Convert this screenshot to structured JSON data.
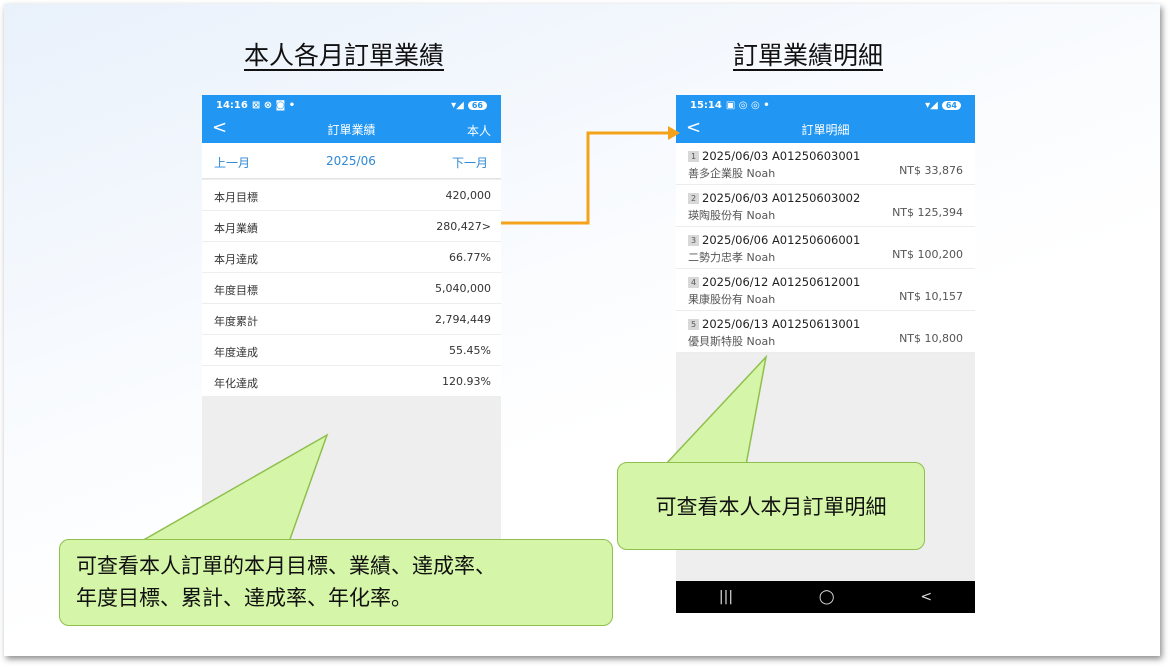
{
  "left_title": "本人各月訂單業績",
  "right_title": "訂單業績明細",
  "left_phone": {
    "status_time": "14:16",
    "status_icons": "⊠ ⊗ ◙ •",
    "battery": "66",
    "nav_back": "<",
    "nav_title": "訂單業績",
    "nav_right": "本人",
    "prev_label": "上一月",
    "month": "2025/06",
    "next_label": "下一月",
    "monthly_rows": [
      {
        "label": "本月目標",
        "value": "420,000"
      },
      {
        "label": "本月業績",
        "value": "280,427>"
      },
      {
        "label": "本月達成",
        "value": "66.77%"
      }
    ],
    "yearly_rows": [
      {
        "label": "年度目標",
        "value": "5,040,000"
      },
      {
        "label": "年度累計",
        "value": "2,794,449"
      },
      {
        "label": "年度達成",
        "value": "55.45%"
      },
      {
        "label": "年化達成",
        "value": "120.93%"
      }
    ]
  },
  "right_phone": {
    "status_time": "15:14",
    "status_icons": "▣ ◎ ◎ •",
    "battery": "64",
    "nav_back": "<",
    "nav_title": "訂單明細",
    "orders": [
      {
        "index": "1",
        "title": "2025/06/03 A01250603001",
        "customer": "善多企業股 Noah",
        "amount": "NT$ 33,876"
      },
      {
        "index": "2",
        "title": "2025/06/03 A01250603002",
        "customer": "瑛陶股份有 Noah",
        "amount": "NT$ 125,394"
      },
      {
        "index": "3",
        "title": "2025/06/06 A01250606001",
        "customer": "二勢力忠孝 Noah",
        "amount": "NT$ 100,200"
      },
      {
        "index": "4",
        "title": "2025/06/12 A01250612001",
        "customer": "果康股份有 Noah",
        "amount": "NT$ 10,157"
      },
      {
        "index": "5",
        "title": "2025/06/13 A01250613001",
        "customer": "優貝斯特股 Noah",
        "amount": "NT$ 10,800"
      }
    ],
    "sys_nav": [
      "|||",
      "◯",
      "<"
    ]
  },
  "left_callout": {
    "line1": "可查看本人訂單的本月目標、業績、達成率、",
    "line2": "年度目標、累計、達成率、年化率。"
  },
  "right_callout": "可查看本人本月訂單明細",
  "colors": {
    "header_blue": "#2196f3",
    "link_blue": "#2f88d6",
    "callout_fill": "#d5f5a8",
    "callout_border": "#8fbf4d",
    "arrow_orange": "#f5a21b"
  }
}
